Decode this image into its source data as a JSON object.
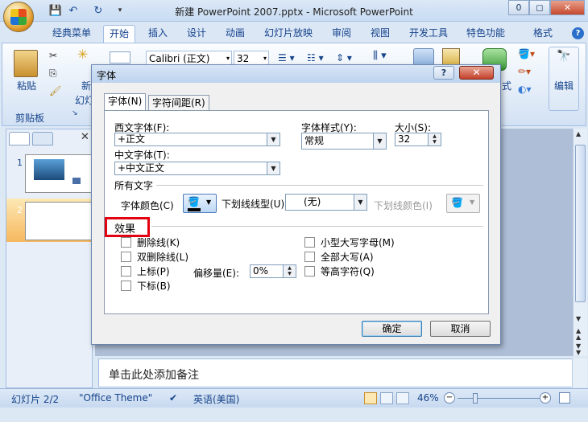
{
  "window": {
    "title": "新建 PowerPoint 2007.pptx - Microsoft PowerPoint",
    "minimize": "0",
    "restore": "◻",
    "close": "✕"
  },
  "qat": {
    "save_icon": "save-icon",
    "undo_icon": "undo-icon",
    "redo_icon": "redo-icon",
    "customize_icon": "dropdown-icon"
  },
  "tabs": [
    {
      "label": "经典菜单"
    },
    {
      "label": "开始"
    },
    {
      "label": "插入"
    },
    {
      "label": "设计"
    },
    {
      "label": "动画"
    },
    {
      "label": "幻灯片放映"
    },
    {
      "label": "审阅"
    },
    {
      "label": "视图"
    },
    {
      "label": "开发工具"
    },
    {
      "label": "特色功能"
    },
    {
      "label": "格式"
    }
  ],
  "ribbon": {
    "paste_label": "粘贴",
    "clipboard_label": "剪贴板",
    "new_slide_label_1": "新",
    "new_slide_label_2": "幻灯",
    "font_name": "Calibri (正文)",
    "font_size": "32",
    "shape_style_label": "式",
    "edit_label": "编辑"
  },
  "left_panel": {
    "slides": [
      {
        "num": "1"
      },
      {
        "num": "2"
      }
    ]
  },
  "notes": {
    "placeholder": "单击此处添加备注"
  },
  "status": {
    "slide_info": "幻灯片 2/2",
    "theme": "\"Office Theme\"",
    "language": "英语(美国)",
    "zoom": "46%"
  },
  "dialog": {
    "title": "字体",
    "help": "?",
    "close": "✕",
    "tabs": [
      {
        "label": "字体(N)"
      },
      {
        "label": "字符间距(R)"
      }
    ],
    "latin_font_label": "西文字体(F):",
    "latin_font_value": "+正文",
    "asian_font_label": "中文字体(T):",
    "asian_font_value": "+中文正文",
    "style_label": "字体样式(Y):",
    "style_value": "常规",
    "size_label": "大小(S):",
    "size_value": "32",
    "all_text_label": "所有文字",
    "font_color_label": "字体颜色(C)",
    "underline_style_label": "下划线线型(U)",
    "underline_style_value": "(无)",
    "underline_color_label": "下划线颜色(I)",
    "effects_label": "效果",
    "effects": {
      "strikethrough": "删除线(K)",
      "double_strikethrough": "双删除线(L)",
      "superscript": "上标(P)",
      "subscript": "下标(B)",
      "offset_label": "偏移量(E):",
      "offset_value": "0%",
      "small_caps": "小型大写字母(M)",
      "all_caps": "全部大写(A)",
      "equalize_height": "等高字符(Q)"
    },
    "ok": "确定",
    "cancel": "取消"
  }
}
